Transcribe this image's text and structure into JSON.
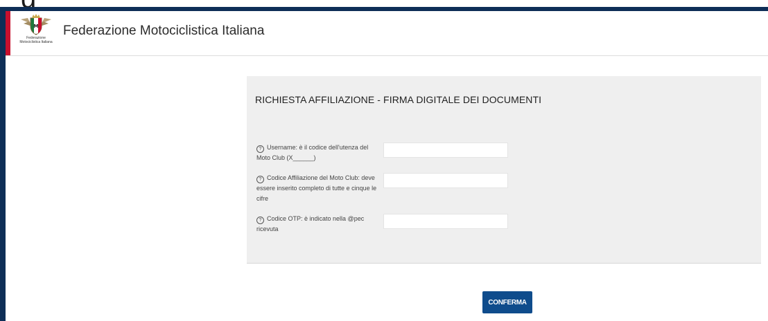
{
  "top_fragment": "g",
  "header": {
    "logo_caption": "Federazione Motociclistica Italiana",
    "title": "Federazione Motociclistica Italiana"
  },
  "panel": {
    "title": "RICHIESTA AFFILIAZIONE - FIRMA DIGITALE DEI DOCUMENTI"
  },
  "form": {
    "help_glyph": "?",
    "fields": [
      {
        "label": "Username: è il codice dell'utenza del Moto Club (X______)",
        "value": ""
      },
      {
        "label": "Codice Affiliazione del Moto Club: deve essere inserito completo di tutte e cinque le cifre",
        "value": ""
      },
      {
        "label": "Codice OTP: è indicato nella @pec ricevuta",
        "value": ""
      }
    ]
  },
  "actions": {
    "confirm_label": "CONFERMA"
  },
  "colors": {
    "brand_red": "#c8102e",
    "primary_button": "#0f4c8c",
    "frame": "#0e2e57"
  }
}
